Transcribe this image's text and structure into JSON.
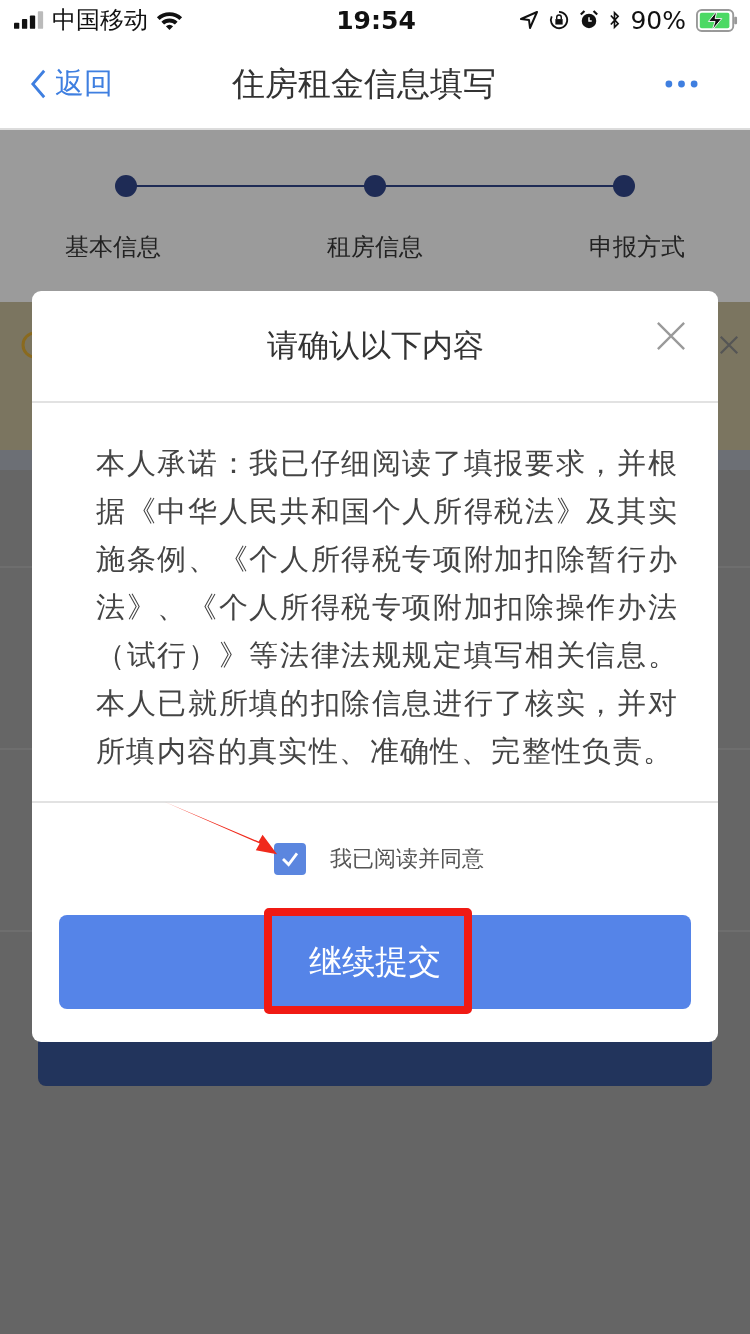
{
  "status_bar": {
    "carrier": "中国移动",
    "time": "19:54",
    "battery": "90%"
  },
  "nav_bar": {
    "back": "返回",
    "title": "住房租金信息填写"
  },
  "steps": [
    {
      "label": "基本信息"
    },
    {
      "label": "租房信息"
    },
    {
      "label": "申报方式"
    }
  ],
  "dialog": {
    "title": "请确认以下内容",
    "body": "本人承诺：我已仔细阅读了填报要求，并根据《中华人民共和国个人所得税法》及其实施条例、《个人所得税专项附加扣除暂行办法》、《个人所得税专项附加扣除操作办法（试行）》等法律法规规定填写相关信息。本人已就所填的扣除信息进行了核实，并对所填内容的真实性、准确性、完整性负责。",
    "agreement": {
      "label": "我已阅读并同意",
      "checked": true
    },
    "confirm_button": {
      "label": "继续提交"
    }
  }
}
